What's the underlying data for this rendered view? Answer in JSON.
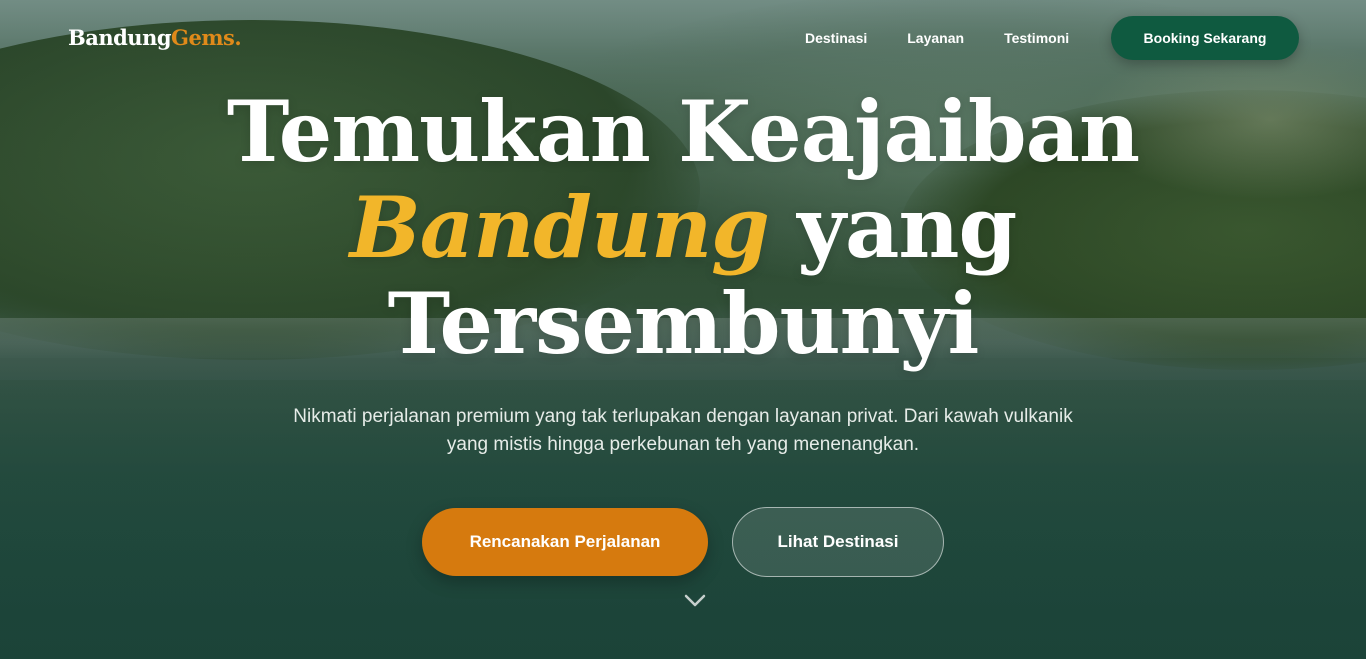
{
  "nav": {
    "logo_main": "Bandung",
    "logo_accent": "Gems.",
    "links": [
      {
        "label": "Destinasi"
      },
      {
        "label": "Layanan"
      },
      {
        "label": "Testimoni"
      }
    ],
    "cta_label": "Booking Sekarang"
  },
  "hero": {
    "title_line1": "Temukan Keajaiban",
    "title_highlight": "Bandung",
    "title_line2_rest": " yang",
    "title_line3": "Tersembunyi",
    "subtitle_line1": "Nikmati perjalanan premium yang tak terlupakan dengan layanan privat. Dari kawah vulkanik",
    "subtitle_line2": "yang mistis hingga perkebunan teh yang menenangkan.",
    "primary_button": "Rencanakan Perjalanan",
    "secondary_button": "Lihat Destinasi",
    "scroll_icon": "chevron-down-icon"
  },
  "colors": {
    "accent_orange": "#d67a0e",
    "highlight_yellow": "#f2b62a",
    "cta_green": "#0f5a40",
    "text_white": "#ffffff"
  }
}
